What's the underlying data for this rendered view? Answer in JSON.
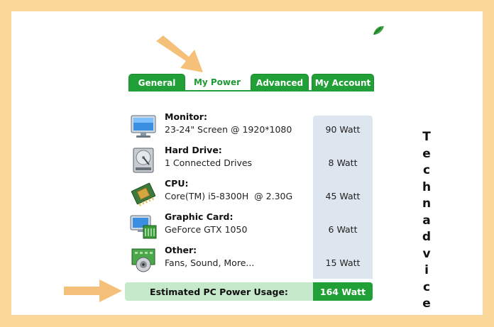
{
  "tabs": [
    {
      "label": "General",
      "active": false
    },
    {
      "label": "My Power",
      "active": true
    },
    {
      "label": "Advanced",
      "active": false
    },
    {
      "label": "My Account",
      "active": false
    }
  ],
  "components": [
    {
      "name": "Monitor:",
      "detail": "23-24\" Screen @ 1920*1080",
      "watt": "90 Watt",
      "icon": "monitor-icon"
    },
    {
      "name": "Hard Drive:",
      "detail": "1 Connected Drives",
      "watt": "8 Watt",
      "icon": "hard-drive-icon"
    },
    {
      "name": "CPU:",
      "detail": "Core(TM) i5-8300H  @ 2.30G",
      "watt": "45 Watt",
      "icon": "cpu-icon"
    },
    {
      "name": "Graphic Card:",
      "detail": "GeForce GTX 1050",
      "watt": "6 Watt",
      "icon": "graphic-card-icon"
    },
    {
      "name": "Other:",
      "detail": "Fans, Sound, More...",
      "watt": "15 Watt",
      "icon": "other-components-icon"
    }
  ],
  "total": {
    "label": "Estimated PC Power Usage:",
    "value": "164 Watt"
  },
  "watermark": [
    "T",
    "e",
    "c",
    "h",
    "n",
    "a",
    "d",
    "v",
    "i",
    "c",
    "e"
  ],
  "colors": {
    "frame": "#fbd89a",
    "accent_green": "#22a038",
    "arrow": "#f5c07a",
    "watt_column": "#dde5ee"
  }
}
